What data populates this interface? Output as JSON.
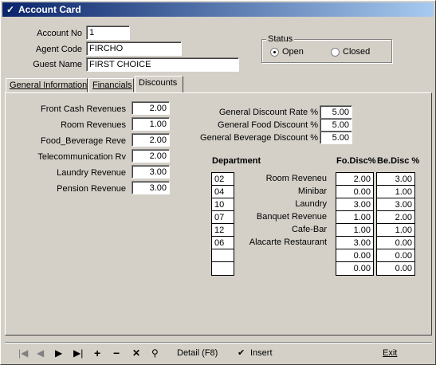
{
  "window": {
    "title": "Account Card"
  },
  "header": {
    "account_no_label": "Account No",
    "account_no": "1",
    "agent_code_label": "Agent Code",
    "agent_code": "FIRCHO",
    "guest_name_label": "Guest Name",
    "guest_name": "FIRST CHOICE"
  },
  "status": {
    "title": "Status",
    "open_label": "Open",
    "closed_label": "Closed",
    "selected": "Open"
  },
  "tabs": [
    {
      "label": "General Information"
    },
    {
      "label": "Financials"
    },
    {
      "label": "Discounts"
    }
  ],
  "revenues": [
    {
      "label": "Front Cash Revenues",
      "value": "2.00"
    },
    {
      "label": "Room Revenues",
      "value": "1.00"
    },
    {
      "label": "Food_Beverage Reve",
      "value": "2.00"
    },
    {
      "label": "Telecommunication Rv",
      "value": "2.00"
    },
    {
      "label": "Laundry Revenue",
      "value": "3.00"
    },
    {
      "label": "Pension Revenue",
      "value": "3.00"
    }
  ],
  "general_discounts": [
    {
      "label": "General Discount Rate %",
      "value": "5.00"
    },
    {
      "label": "General Food Discount %",
      "value": "5.00"
    },
    {
      "label": "General Beverage Discount %",
      "value": "5.00"
    }
  ],
  "department_table": {
    "department_header": "Department",
    "fo_disc_header": "Fo.Disc%",
    "be_disc_header": "Be.Disc %",
    "codes": [
      "02",
      "04",
      "10",
      "07",
      "12",
      "06",
      "",
      ""
    ],
    "names": [
      "Room Reveneu",
      "Minibar",
      "Laundry",
      "Banquet Revenue",
      "Cafe-Bar",
      "Alacarte Restaurant",
      "",
      ""
    ],
    "fo_disc": [
      "2.00",
      "0.00",
      "3.00",
      "1.00",
      "1.00",
      "3.00",
      "0.00",
      "0.00"
    ],
    "be_disc": [
      "3.00",
      "1.00",
      "3.00",
      "2.00",
      "1.00",
      "0.00",
      "0.00",
      "0.00"
    ]
  },
  "toolbar": {
    "detail_label": "Detail (F8)",
    "insert_label": "Insert",
    "exit_label": "Exit"
  }
}
